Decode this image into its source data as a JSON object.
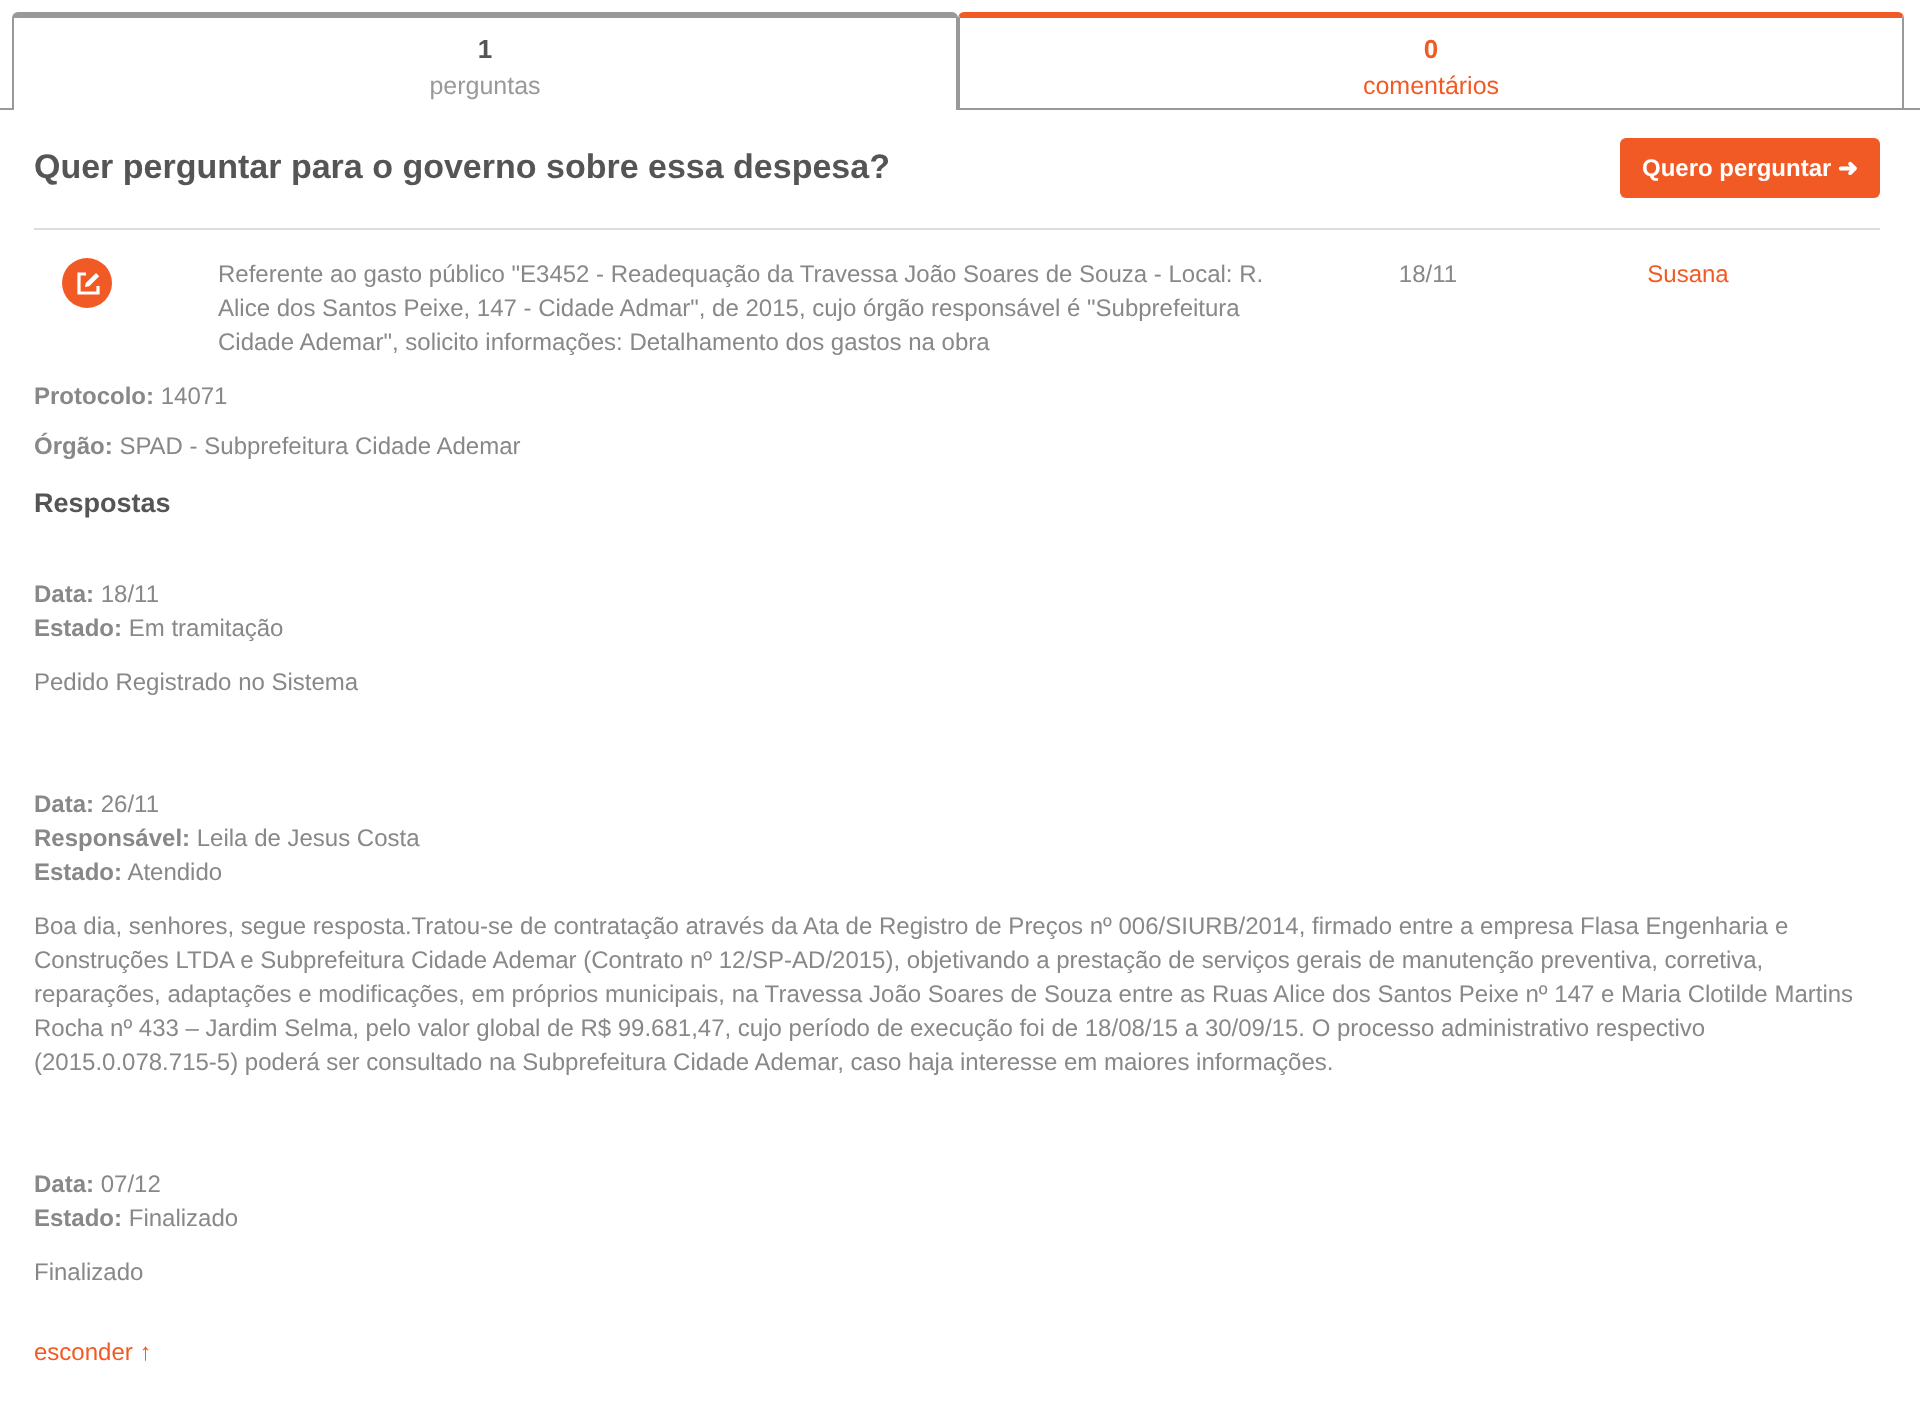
{
  "tabs": [
    {
      "count": "1",
      "label": "perguntas",
      "selected": true
    },
    {
      "count": "0",
      "label": "comentários",
      "selected": false
    }
  ],
  "heading": "Quer perguntar para o governo sobre essa despesa?",
  "ask_button": "Quero perguntar ➜",
  "question": {
    "text": "Referente ao gasto público \"E3452 - Readequação da Travessa João Soares de Souza - Local: R. Alice dos Santos Peixe, 147 - Cidade Admar\", de 2015, cujo órgão responsável é \"Subprefeitura Cidade Ademar\", solicito informações: Detalhamento dos gastos na obra",
    "date": "18/11",
    "author": "Susana"
  },
  "details": [
    {
      "label": "Protocolo:",
      "value": "14071"
    },
    {
      "label": "Órgão:",
      "value": "SPAD - Subprefeitura Cidade Ademar"
    }
  ],
  "answers_title": "Respostas",
  "answers": [
    {
      "fields": [
        {
          "label": "Data:",
          "value": "18/11"
        },
        {
          "label": "Estado:",
          "value": "Em tramitação"
        }
      ],
      "text": "Pedido Registrado no Sistema"
    },
    {
      "fields": [
        {
          "label": "Data:",
          "value": "26/11"
        },
        {
          "label": "Responsável:",
          "value": "Leila de Jesus Costa"
        },
        {
          "label": "Estado:",
          "value": "Atendido"
        }
      ],
      "text": "Boa dia, senhores, segue resposta.Tratou-se de contratação através da Ata de Registro de Preços nº 006/SIURB/2014, firmado entre a empresa Flasa Engenharia e Construções LTDA e Subprefeitura Cidade Ademar (Contrato nº 12/SP-AD/2015), objetivando a prestação de serviços gerais de manutenção preventiva, corretiva, reparações, adaptações e modificações, em próprios municipais, na Travessa João Soares de Souza entre as Ruas Alice dos Santos Peixe nº 147 e Maria Clotilde Martins Rocha nº 433 – Jardim Selma, pelo valor global de R$ 99.681,47, cujo período de execução foi de 18/08/15 a 30/09/15. O processo administrativo respectivo (2015.0.078.715-5) poderá ser consultado na Subprefeitura Cidade Ademar, caso haja interesse em maiores informações."
    },
    {
      "fields": [
        {
          "label": "Data:",
          "value": "07/12"
        },
        {
          "label": "Estado:",
          "value": "Finalizado"
        }
      ],
      "text": "Finalizado"
    }
  ],
  "hide_link": "esconder ↑"
}
